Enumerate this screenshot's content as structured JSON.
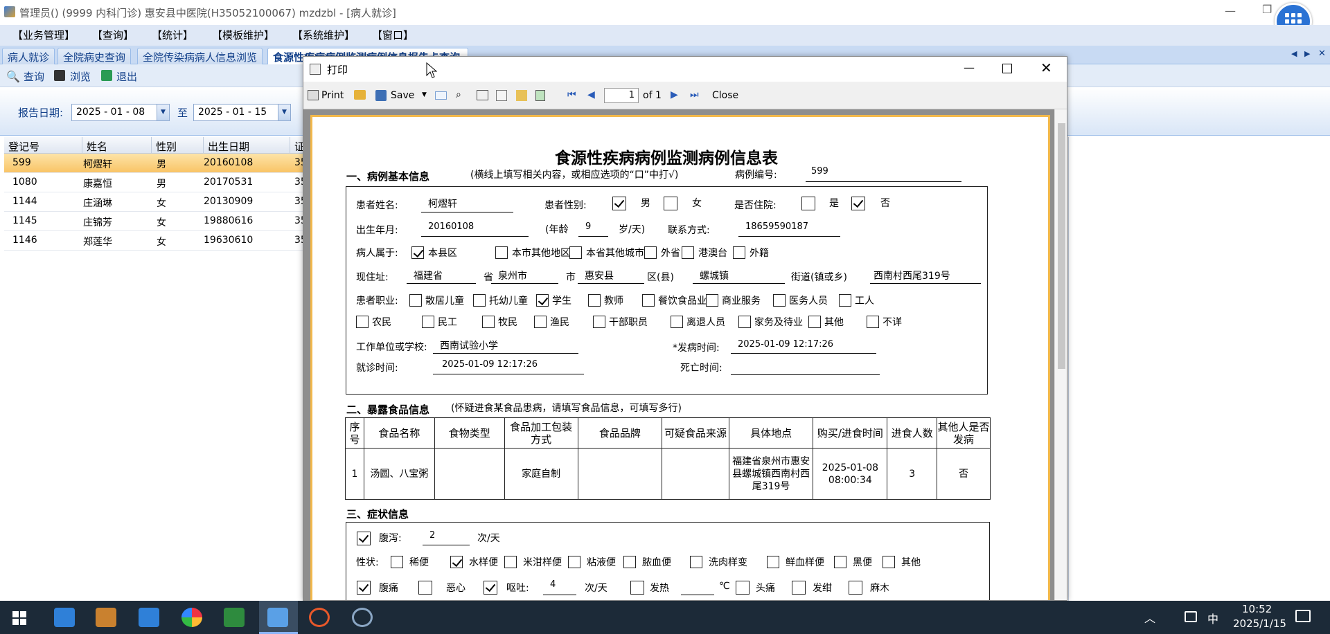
{
  "app": {
    "title": "管理员() (9999 内科门诊) 惠安县中医院(H35052100067) mzdzbl - [病人就诊]"
  },
  "menu": [
    "【业务管理】",
    "【查询】",
    "【统计】",
    "【模板维护】",
    "【系统维护】",
    "【窗口】"
  ],
  "tabs": [
    "病人就诊",
    "全院病史查询",
    "全院传染病病人信息浏览",
    "食源性疾病病例监测病例信息报告卡查询"
  ],
  "toolbar": {
    "query": "查询",
    "browse": "浏览",
    "exit": "退出"
  },
  "filter": {
    "label": "报告日期:",
    "from": "2025 - 01 - 08",
    "to_label": "至",
    "to": "2025 - 01 - 15"
  },
  "grid": {
    "columns": [
      "登记号",
      "姓名",
      "性别",
      "出生日期",
      "证"
    ],
    "rows": [
      {
        "id": "599",
        "name": "柯熤轩",
        "sex": "男",
        "dob": "20160108",
        "c": "35"
      },
      {
        "id": "1080",
        "name": "康嘉恒",
        "sex": "男",
        "dob": "20170531",
        "c": "35"
      },
      {
        "id": "1144",
        "name": "庄涵琳",
        "sex": "女",
        "dob": "20130909",
        "c": "35"
      },
      {
        "id": "1145",
        "name": "庄锦芳",
        "sex": "女",
        "dob": "19880616",
        "c": "35"
      },
      {
        "id": "1146",
        "name": "郑莲华",
        "sex": "女",
        "dob": "19630610",
        "c": "35"
      }
    ]
  },
  "dialog": {
    "title": "打印",
    "toolbar": {
      "print": "Print",
      "save": "Save",
      "page": "1",
      "of": "of 1",
      "close": "Close"
    }
  },
  "report": {
    "title": "食源性疾病病例监测病例信息表",
    "sec1": "一、病例基本信息",
    "sec1_note": "(横线上填写相关内容，或相应选项的“口”中打√)",
    "case_no_label": "病例编号:",
    "case_no": "599",
    "name_label": "患者姓名:",
    "name": "柯熤轩",
    "sex_label": "患者性别:",
    "male": "男",
    "female": "女",
    "inpatient_label": "是否住院:",
    "yes": "是",
    "no": "否",
    "dob_label": "出生年月:",
    "dob": "20160108",
    "age_pre": "(年龄",
    "age": "9",
    "age_unit": "岁/天)",
    "contact_label": "联系方式:",
    "contact": "18659590187",
    "belong_label": "病人属于:",
    "belong": [
      "本县区",
      "本市其他地区",
      "本省其他城市",
      "外省",
      "港澳台",
      "外籍"
    ],
    "addr_label": "现住址:",
    "province": "福建省",
    "province_u": "省",
    "city": "泉州市",
    "city_u": "市",
    "county": "惠安县",
    "county_u": "区(县)",
    "town": "螺城镇",
    "town_u": "街道(镇或乡)",
    "street": "西南村西尾319号",
    "job_label": "患者职业:",
    "jobs1": [
      "散居儿童",
      "托幼儿童",
      "学生",
      "教师",
      "餐饮食品业",
      "商业服务",
      "医务人员",
      "工人"
    ],
    "jobs2": [
      "农民",
      "民工",
      "牧民",
      "渔民",
      "干部职员",
      "离退人员",
      "家务及待业",
      "其他",
      "不详"
    ],
    "work_label": "工作单位或学校:",
    "work": "西南试验小学",
    "onset_label": "*发病时间:",
    "onset": "2025-01-09 12:17:26",
    "visit_label": "就诊时间:",
    "visit": "2025-01-09 12:17:26",
    "death_label": "死亡时间:",
    "sec2": "二、暴露食品信息",
    "sec2_note": "(怀疑进食某食品患病，请填写食品信息，可填写多行)",
    "food_headers": [
      "序号",
      "食品名称",
      "食物类型",
      "食品加工包装方式",
      "食品品牌",
      "可疑食品来源",
      "具体地点",
      "购买/进食时间",
      "进食人数",
      "其他人是否发病"
    ],
    "food_row": [
      "1",
      "汤圆、八宝粥",
      "",
      "家庭自制",
      "",
      "",
      "福建省泉州市惠安县螺城镇西南村西尾319号",
      "2025-01-08 08:00:34",
      "3",
      "否"
    ],
    "sec3": "三、症状信息",
    "diarrhea": "腹泻:",
    "diarrhea_n": "2",
    "per_day": "次/天",
    "shape_label": "性状:",
    "shapes": [
      "稀便",
      "水样便",
      "米泔样便",
      "粘液便",
      "脓血便",
      "洗肉样变",
      "鲜血样便",
      "黑便",
      "其他"
    ],
    "abd": "腹痛",
    "nausea": "恶心",
    "vomit": "呕吐:",
    "vomit_n": "4",
    "vomit_unit": "次/天",
    "fever": "发热",
    "deg": "℃",
    "headache": "头痛",
    "cyanosis": "发绀",
    "numb": "麻木"
  },
  "taskbar": {
    "ime": "中",
    "time": "10:52",
    "date": "2025/1/15"
  }
}
